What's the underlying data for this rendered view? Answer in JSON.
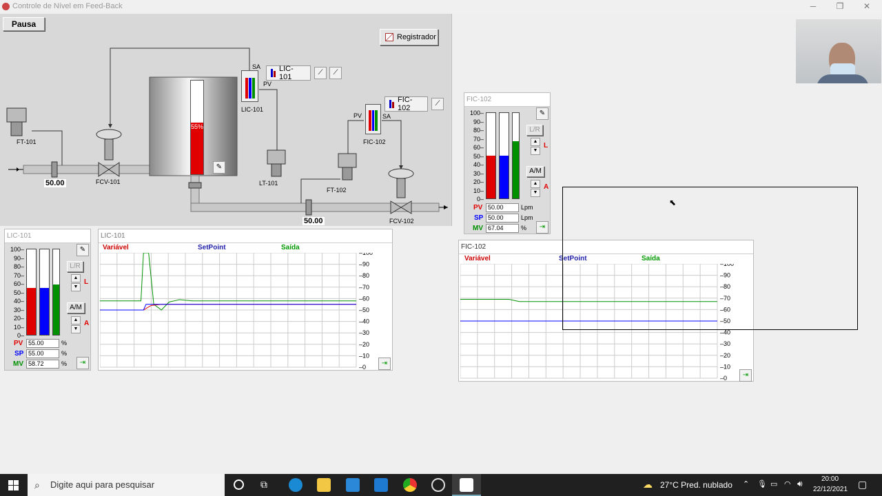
{
  "window": {
    "title": "Controle de Nível em Feed-Back"
  },
  "toolbar": {
    "pause_label": "Pausa",
    "recorder_label": "Registrador"
  },
  "process": {
    "lic_tag": "LIC-101",
    "fic_tag": "FIC-102",
    "ft101": "FT-101",
    "fcv101": "FCV-101",
    "lt101": "LT-101",
    "ft102": "FT-102",
    "fcv102": "FCV-102",
    "lic101_label": "LIC-101",
    "fic102_label": "FIC-102",
    "sa1": "SA",
    "pv1": "PV",
    "sa2": "SA",
    "pv2": "PV",
    "inlet_flow": "50.00",
    "outlet_flow": "50.00",
    "tank_level_text": "55%",
    "tank_level": 55
  },
  "lic_face": {
    "title": "LIC-101",
    "scale": [
      "100",
      "90",
      "80",
      "70",
      "60",
      "50",
      "40",
      "30",
      "20",
      "10",
      "0"
    ],
    "pv": 55.0,
    "sp": 55.0,
    "mv": 58.72,
    "lr_label": "L/R",
    "l_label": "L",
    "am_label": "A/M",
    "a_label": "A",
    "pv_label": "PV",
    "sp_label": "SP",
    "mv_label": "MV",
    "pv_text": "55.00",
    "sp_text": "55.00",
    "mv_text": "58.72",
    "pv_unit": "%",
    "sp_unit": "%",
    "mv_unit": "%"
  },
  "fic_face": {
    "title": "FIC-102",
    "scale": [
      "100",
      "90",
      "80",
      "70",
      "60",
      "50",
      "40",
      "30",
      "20",
      "10",
      "0"
    ],
    "pv": 50.0,
    "sp": 50.0,
    "mv": 67.04,
    "lr_label": "L/R",
    "l_label": "L",
    "am_label": "A/M",
    "a_label": "A",
    "pv_label": "PV",
    "sp_label": "SP",
    "mv_label": "MV",
    "pv_text": "50.00",
    "sp_text": "50.00",
    "mv_text": "67.04",
    "pv_unit": "Lpm",
    "sp_unit": "Lpm",
    "mv_unit": "%"
  },
  "lic_trend": {
    "title": "LIC-101",
    "legend": [
      "Variável",
      "SetPoint",
      "Saída"
    ],
    "ticks": [
      "100",
      "90",
      "80",
      "70",
      "60",
      "50",
      "40",
      "30",
      "20",
      "10",
      "0"
    ]
  },
  "fic_trend": {
    "title": "FIC-102",
    "legend": [
      "Variável",
      "SetPoint",
      "Saída"
    ],
    "ticks": [
      "100",
      "90",
      "80",
      "70",
      "60",
      "50",
      "40",
      "30",
      "20",
      "10",
      "0"
    ]
  },
  "taskbar": {
    "search_placeholder": "Digite aqui para pesquisar",
    "weather": "27°C  Pred. nublado",
    "time": "20:00",
    "date": "22/12/2021"
  },
  "colors": {
    "pv": "#e00000",
    "sp": "#0000ff",
    "mv": "#009000"
  }
}
